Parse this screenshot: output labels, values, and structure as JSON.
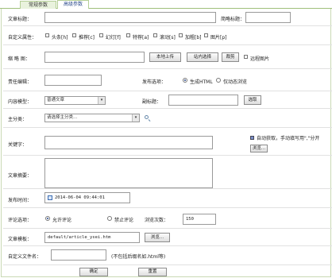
{
  "tabs": [
    {
      "label": "常规参数"
    },
    {
      "label": "高级参数"
    }
  ],
  "form": {
    "title": {
      "label": "文章标题：",
      "value": ""
    },
    "short_title": {
      "label": "简略标题：",
      "value": ""
    },
    "attributes": {
      "label": "自定义属性：",
      "items": [
        {
          "label": "头条[h]",
          "checked": false
        },
        {
          "label": "推荐[c]",
          "checked": false
        },
        {
          "label": "幻灯[f]",
          "checked": false
        },
        {
          "label": "特荐[a]",
          "checked": false
        },
        {
          "label": "滚动[s]",
          "checked": false
        },
        {
          "label": "加粗[b]",
          "checked": false
        },
        {
          "label": "图片[p]",
          "checked": false
        }
      ]
    },
    "thumb": {
      "label": "缩 略 图：",
      "value": "",
      "upload_label": "本地上传",
      "select_label": "站内选择",
      "crop_label": "裁剪",
      "remote_label": "远程图片",
      "remote_checked": false
    },
    "author": {
      "label": "责任编辑：",
      "value": ""
    },
    "publish_option": {
      "label": "发布选项：",
      "options": [
        {
          "label": "生成HTML",
          "selected": true
        },
        {
          "label": "仅动态浏览",
          "selected": false
        }
      ]
    },
    "content_model": {
      "label": "内容模型：",
      "value": "普通文章"
    },
    "subtitle": {
      "label": "副标题：",
      "value": "",
      "button_label": "选取"
    },
    "main_category": {
      "label": "主分类：",
      "value": "请选择主分类..."
    },
    "keywords": {
      "label": "关键字：",
      "value": "",
      "auto_label": "自动获取，手动填写用\",\"分开",
      "auto_checked": true,
      "browse_label": "浏览..."
    },
    "summary": {
      "label": "文章摘要：",
      "value": ""
    },
    "publish_time": {
      "label": "发布时间：",
      "value": "2014-06-04 09:44:01"
    },
    "comment_option": {
      "label": "评论选项：",
      "options": [
        {
          "label": "允许评论",
          "selected": true
        },
        {
          "label": "禁止评论",
          "selected": false
        }
      ]
    },
    "click_count": {
      "label": "浏览次数：",
      "value": "150"
    },
    "template": {
      "label": "文章模板：",
      "value": "default/article_ysei.htm",
      "browse_label": "浏览..."
    },
    "custom_filename": {
      "label": "自定义文件名：",
      "value": "",
      "hint": "(不包括后缀名如.html等)"
    }
  },
  "footer": {
    "confirm_label": "确定",
    "reset_label": "重置"
  }
}
